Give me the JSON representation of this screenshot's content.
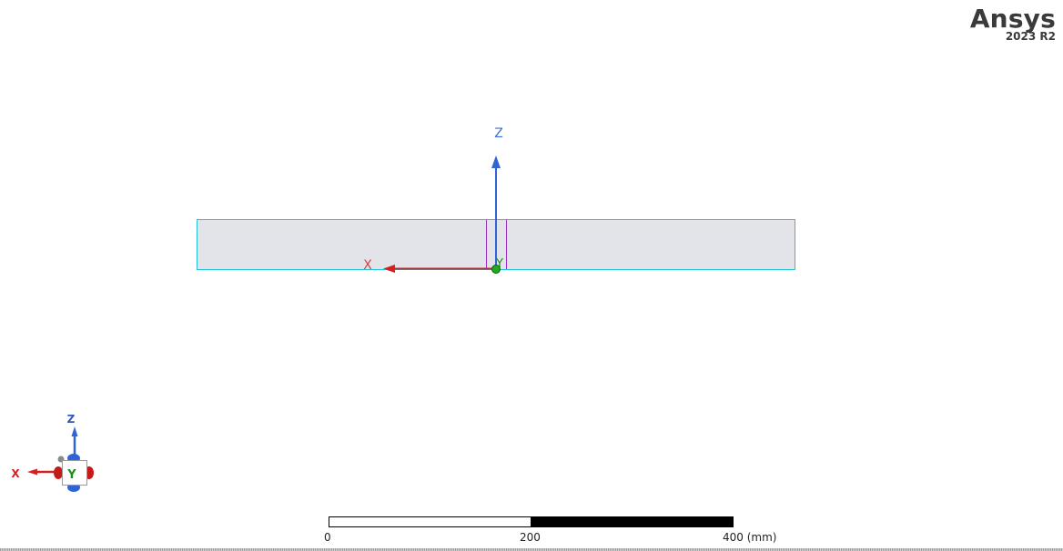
{
  "app": {
    "brand": "Ansys",
    "version": "2023 R2"
  },
  "model_axes": {
    "x_label": "X",
    "y_label": "Y",
    "z_label": "Z",
    "x_color": "#e02020",
    "y_color": "#1a8f1a",
    "z_color": "#3a6fd8"
  },
  "triad": {
    "x_label": "X",
    "y_label": "Y",
    "z_label": "Z"
  },
  "body": {
    "fill_color": "#e2e4ea",
    "edge_color": "#22c3d8",
    "feature_line_color": "#9a2fbf"
  },
  "scale_bar": {
    "labels": [
      "0",
      "200",
      "400 (mm)"
    ]
  }
}
